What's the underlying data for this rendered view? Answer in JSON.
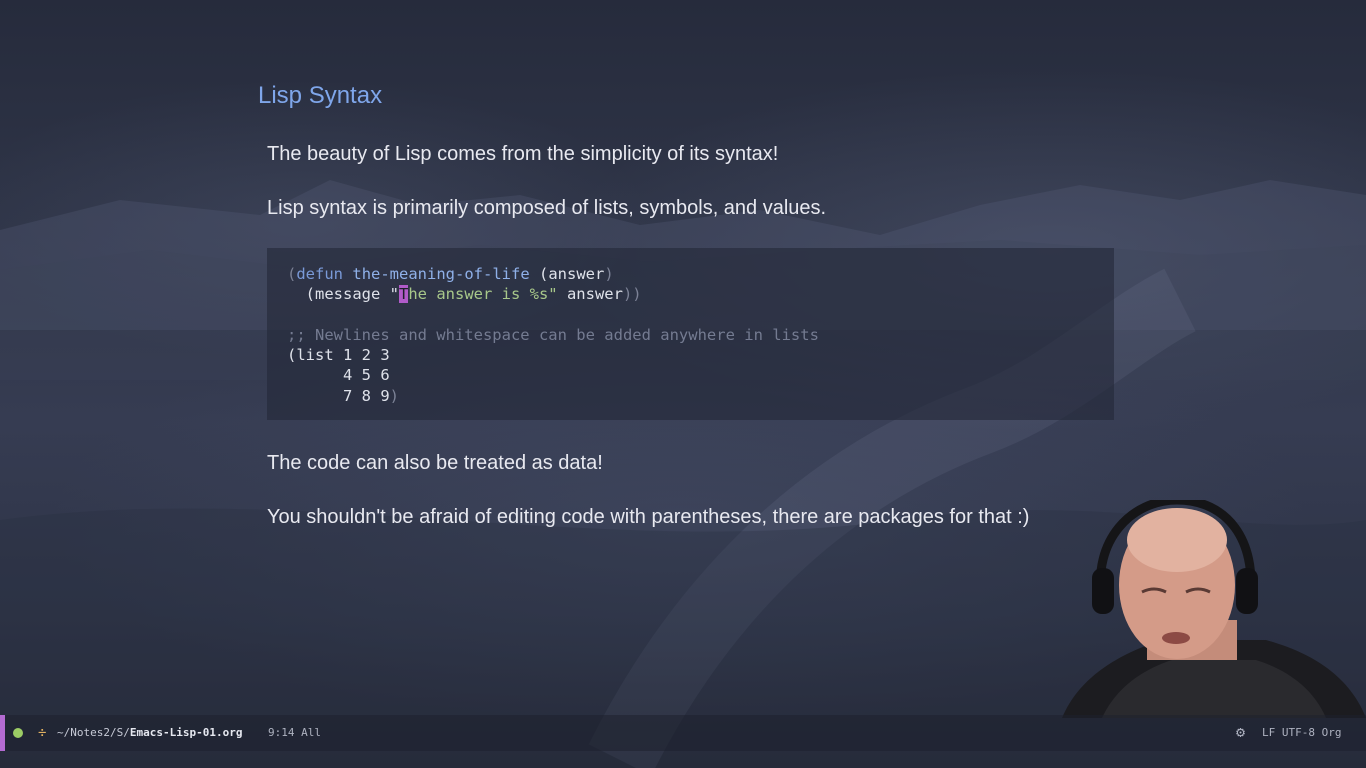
{
  "slide": {
    "heading": "Lisp Syntax",
    "paragraphs": [
      "The beauty of Lisp comes from the simplicity of its syntax!",
      "Lisp syntax is primarily composed of lists, symbols, and values.",
      "The code can also be treated as data!",
      "You shouldn't be afraid of editing code with parentheses, there are packages for that :)"
    ]
  },
  "code": {
    "l1_open": "(",
    "l1_defun": "defun",
    "l1_name": "the-meaning-of-life",
    "l1_arg": "(answer",
    "l1_close": ")",
    "l2_pre": "  (message \"",
    "l2_cursor": "T",
    "l2_str": "he answer is %s\"",
    "l2_post": " answer",
    "l2_close": "))",
    "l3": "",
    "l4_comment": ";; Newlines and whitespace can be added anywhere in lists",
    "l5": "(list 1 2 3",
    "l6": "      4 5 6",
    "l7": "      7 8 9",
    "l7_close": ")"
  },
  "modeline": {
    "path_prefix": "~/Notes2/S/",
    "filename": "Emacs-Lisp-01.org",
    "position": "9:14 All",
    "encoding": "LF UTF-8",
    "mode": "Org"
  },
  "colors": {
    "heading": "#7fa6ea",
    "cursor": "#b15bc9",
    "modeline_accent": "#b46bd2",
    "status_dot": "#9ccc65"
  },
  "icons": [
    "status-dot-icon",
    "buffer-modified-icon",
    "gear-icon",
    "org-mode-icon"
  ]
}
